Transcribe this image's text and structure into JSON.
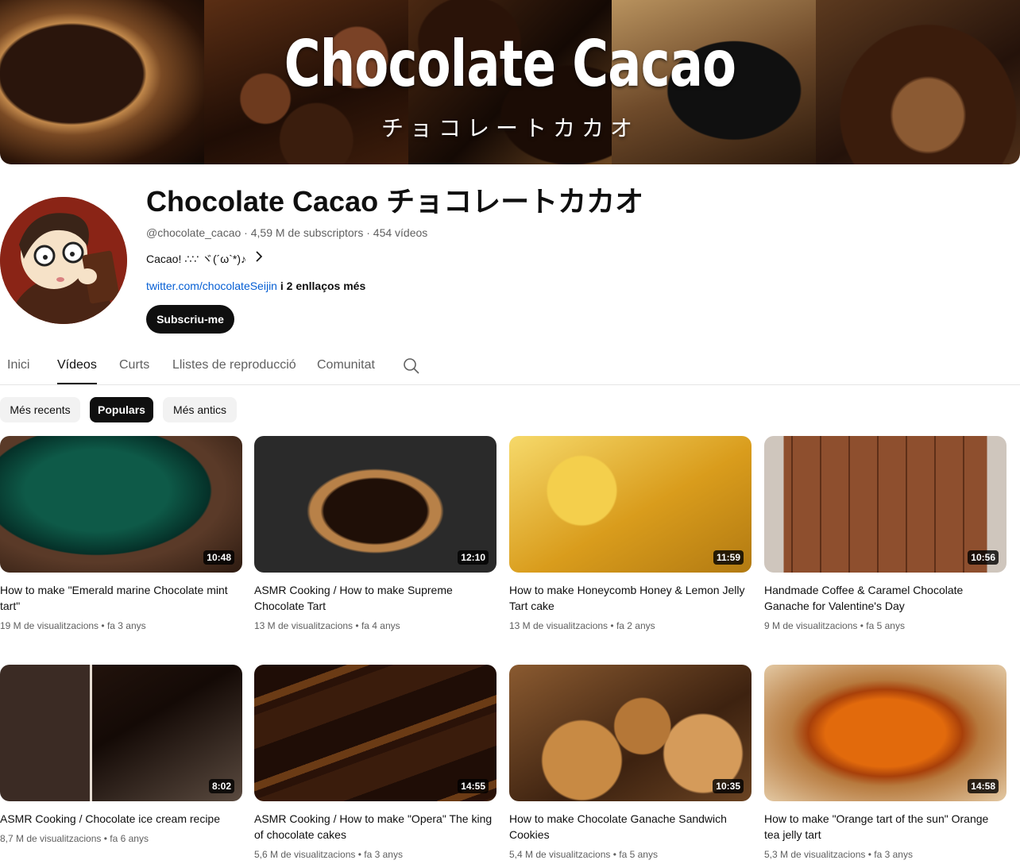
{
  "banner": {
    "title": "Chocolate Cacao",
    "subtitle": "チョコレートカカオ"
  },
  "channel": {
    "name": "Chocolate Cacao チョコレートカカオ",
    "meta": "@chocolate_cacao · 4,59 M de subscriptors · 454 vídeos",
    "description": "Cacao! ∴∵ ヾ(´ω`*)♪",
    "link": "twitter.com/chocolateSeijin",
    "more_links": " i 2 enllaços més",
    "subscribe_label": "Subscriu-me"
  },
  "tabs": [
    {
      "label": "Inici",
      "active": false
    },
    {
      "label": "Vídeos",
      "active": true
    },
    {
      "label": "Curts",
      "active": false
    },
    {
      "label": "Llistes de reproducció",
      "active": false
    },
    {
      "label": "Comunitat",
      "active": false
    }
  ],
  "chips": [
    {
      "label": "Més recents",
      "active": false
    },
    {
      "label": "Populars",
      "active": true
    },
    {
      "label": "Més antics",
      "active": false
    }
  ],
  "videos": [
    {
      "title": "How to make \"Emerald marine Chocolate mint tart\"",
      "views": "19 M de visualitzacions",
      "age": "fa 3 anys",
      "duration": "10:48"
    },
    {
      "title": "ASMR Cooking / How to make Supreme Chocolate Tart",
      "views": "13 M de visualitzacions",
      "age": "fa 4 anys",
      "duration": "12:10"
    },
    {
      "title": "How to make Honeycomb Honey & Lemon Jelly Tart cake",
      "views": "13 M de visualitzacions",
      "age": "fa 2 anys",
      "duration": "11:59"
    },
    {
      "title": "Handmade Coffee & Caramel Chocolate Ganache for Valentine's Day",
      "views": "9 M de visualitzacions",
      "age": "fa 5 anys",
      "duration": "10:56"
    },
    {
      "title": "ASMR Cooking / Chocolate ice cream recipe",
      "views": "8,7 M de visualitzacions",
      "age": "fa 6 anys",
      "duration": "8:02"
    },
    {
      "title": "ASMR Cooking / How to make \"Opera\" The king of chocolate cakes",
      "views": "5,6 M de visualitzacions",
      "age": "fa 3 anys",
      "duration": "14:55"
    },
    {
      "title": "How to make Chocolate Ganache Sandwich Cookies",
      "views": "5,4 M de visualitzacions",
      "age": "fa 5 anys",
      "duration": "10:35"
    },
    {
      "title": "How to make \"Orange tart of the sun\" Orange tea jelly tart",
      "views": "5,3 M de visualitzacions",
      "age": "fa 3 anys",
      "duration": "14:58"
    }
  ]
}
